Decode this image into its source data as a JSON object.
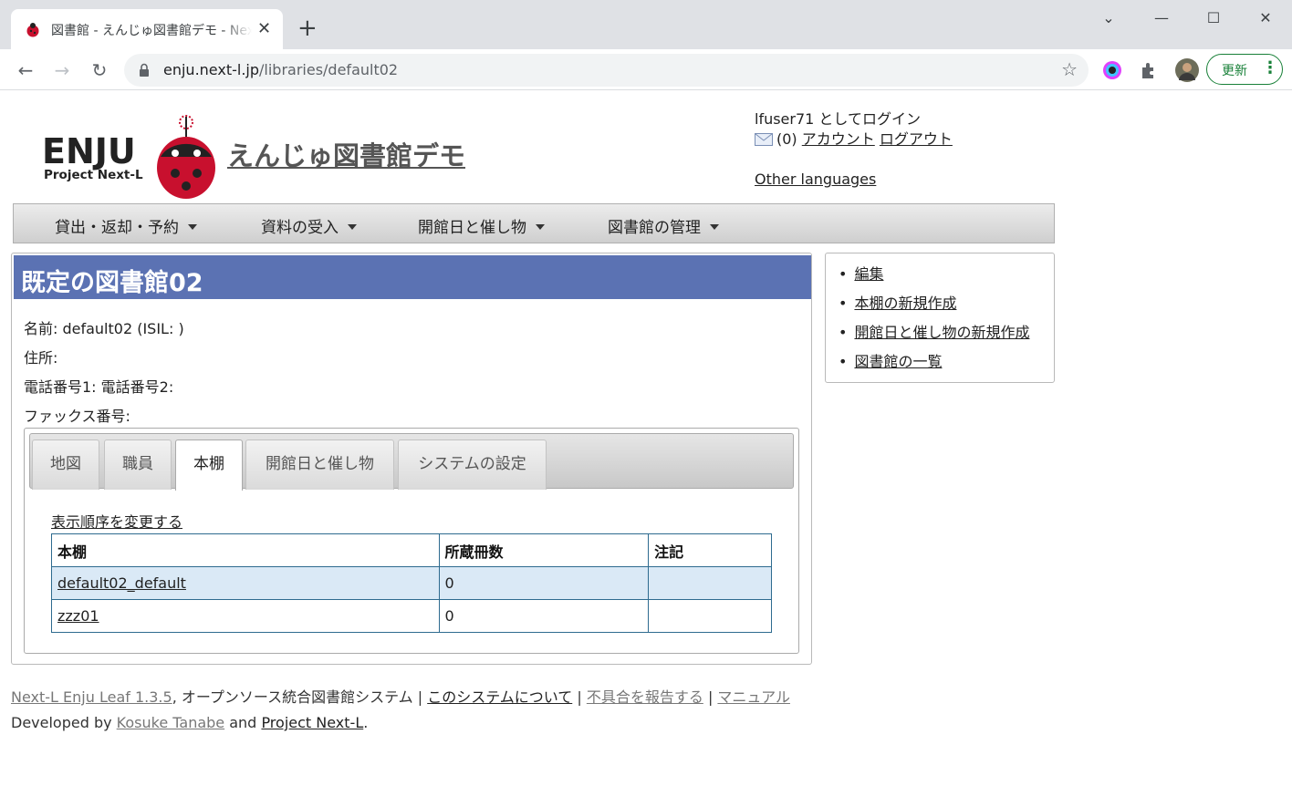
{
  "browser": {
    "tab_title": "図書館 - えんじゅ図書館デモ - Next-L Enju",
    "tab_close": "✕",
    "new_tab": "+",
    "url_host": "enju.next-l.jp",
    "url_path": "/libraries/default02",
    "update_label": "更新",
    "window_controls": {
      "dropdown": "⌄",
      "minimize": "—",
      "maximize": "☐",
      "close": "✕"
    },
    "accent_color": "#188038"
  },
  "header": {
    "site_title": "えんじゅ図書館デモ",
    "logo_text_1": "ENJU",
    "logo_text_2": "Project Next-L",
    "login_status": "lfuser71 としてログイン",
    "mail_count": "(0)",
    "account_link": "アカウント",
    "logout_link": "ログアウト",
    "other_languages": "Other languages"
  },
  "menu": {
    "items": [
      {
        "label": "貸出・返却・予約"
      },
      {
        "label": "資料の受入"
      },
      {
        "label": "開館日と催し物"
      },
      {
        "label": "図書館の管理"
      }
    ]
  },
  "library": {
    "heading": "既定の図書館02",
    "name_line": "名前: default02 (ISIL: )",
    "address_line": "住所:",
    "phone_line": "電話番号1: 電話番号2:",
    "fax_line": "ファックス番号:",
    "header_color": "#5b72b3"
  },
  "tabs": [
    {
      "label": "地図",
      "active": false
    },
    {
      "label": "職員",
      "active": false
    },
    {
      "label": "本棚",
      "active": true
    },
    {
      "label": "開館日と催し物",
      "active": false
    },
    {
      "label": "システムの設定",
      "active": false
    }
  ],
  "shelves": {
    "reorder_link": "表示順序を変更する",
    "columns": [
      "本棚",
      "所蔵冊数",
      "注記"
    ],
    "rows": [
      {
        "name": "default02_default",
        "count": "0",
        "note": ""
      },
      {
        "name": "zzz01",
        "count": "0",
        "note": ""
      }
    ]
  },
  "sidebar": {
    "links": [
      {
        "label": "編集"
      },
      {
        "label": "本棚の新規作成"
      },
      {
        "label": "開館日と催し物の新規作成"
      },
      {
        "label": "図書館の一覧"
      }
    ]
  },
  "footer": {
    "product_link": "Next-L Enju Leaf 1.3.5",
    "product_desc": ", オープンソース統合図書館システム",
    "sep": "|",
    "about_link": "このシステムについて",
    "report_link": "不具合を報告する",
    "manual_link": "マニュアル",
    "developed_by": "Developed by",
    "author_link": "Kosuke Tanabe",
    "and": "and",
    "project_link": "Project Next-L",
    "period": "."
  }
}
